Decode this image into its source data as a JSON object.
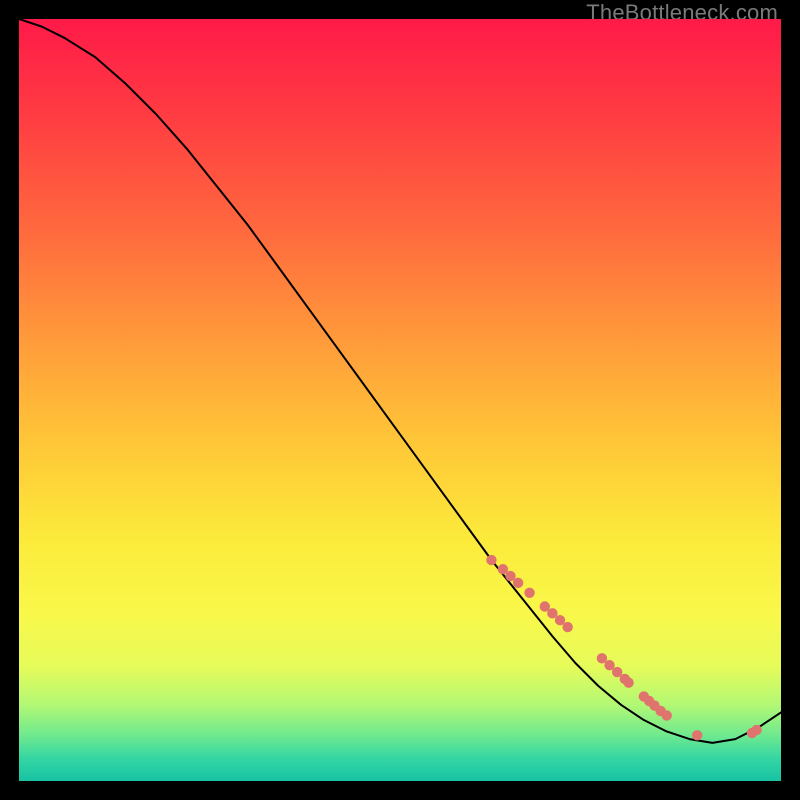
{
  "watermark": "TheBottleneck.com",
  "colors": {
    "marker": "#e0736d",
    "curve": "#000000",
    "frame": "#000000"
  },
  "chart_data": {
    "type": "line",
    "title": "",
    "xlabel": "",
    "ylabel": "",
    "xlim": [
      0,
      100
    ],
    "ylim": [
      0,
      100
    ],
    "grid": false,
    "legend": false,
    "series": [
      {
        "name": "curve",
        "x": [
          0,
          3,
          6,
          10,
          14,
          18,
          22,
          26,
          30,
          34,
          38,
          42,
          46,
          50,
          54,
          58,
          62,
          66,
          70,
          73,
          76,
          79,
          82,
          85,
          88,
          91,
          94,
          97,
          100
        ],
        "y": [
          100,
          99,
          97.5,
          95,
          91.5,
          87.5,
          83,
          78,
          73,
          67.5,
          62,
          56.5,
          51,
          45.5,
          40,
          34.5,
          29,
          24,
          19,
          15.5,
          12.5,
          10,
          8,
          6.5,
          5.5,
          5,
          5.5,
          7,
          9
        ]
      }
    ],
    "markers": {
      "name": "highlighted-points",
      "x": [
        62,
        63.5,
        64.5,
        65.5,
        67,
        69,
        70,
        71,
        72,
        76.5,
        77.5,
        78.5,
        79.5,
        80,
        82,
        82.7,
        83.4,
        84.2,
        85,
        89,
        96.2,
        96.8
      ],
      "y": [
        29,
        27.8,
        26.9,
        26,
        24.7,
        22.9,
        22,
        21.1,
        20.2,
        16.1,
        15.2,
        14.3,
        13.4,
        12.9,
        11.1,
        10.5,
        9.9,
        9.2,
        8.6,
        6,
        6.3,
        6.7
      ],
      "r": 5.2
    }
  }
}
